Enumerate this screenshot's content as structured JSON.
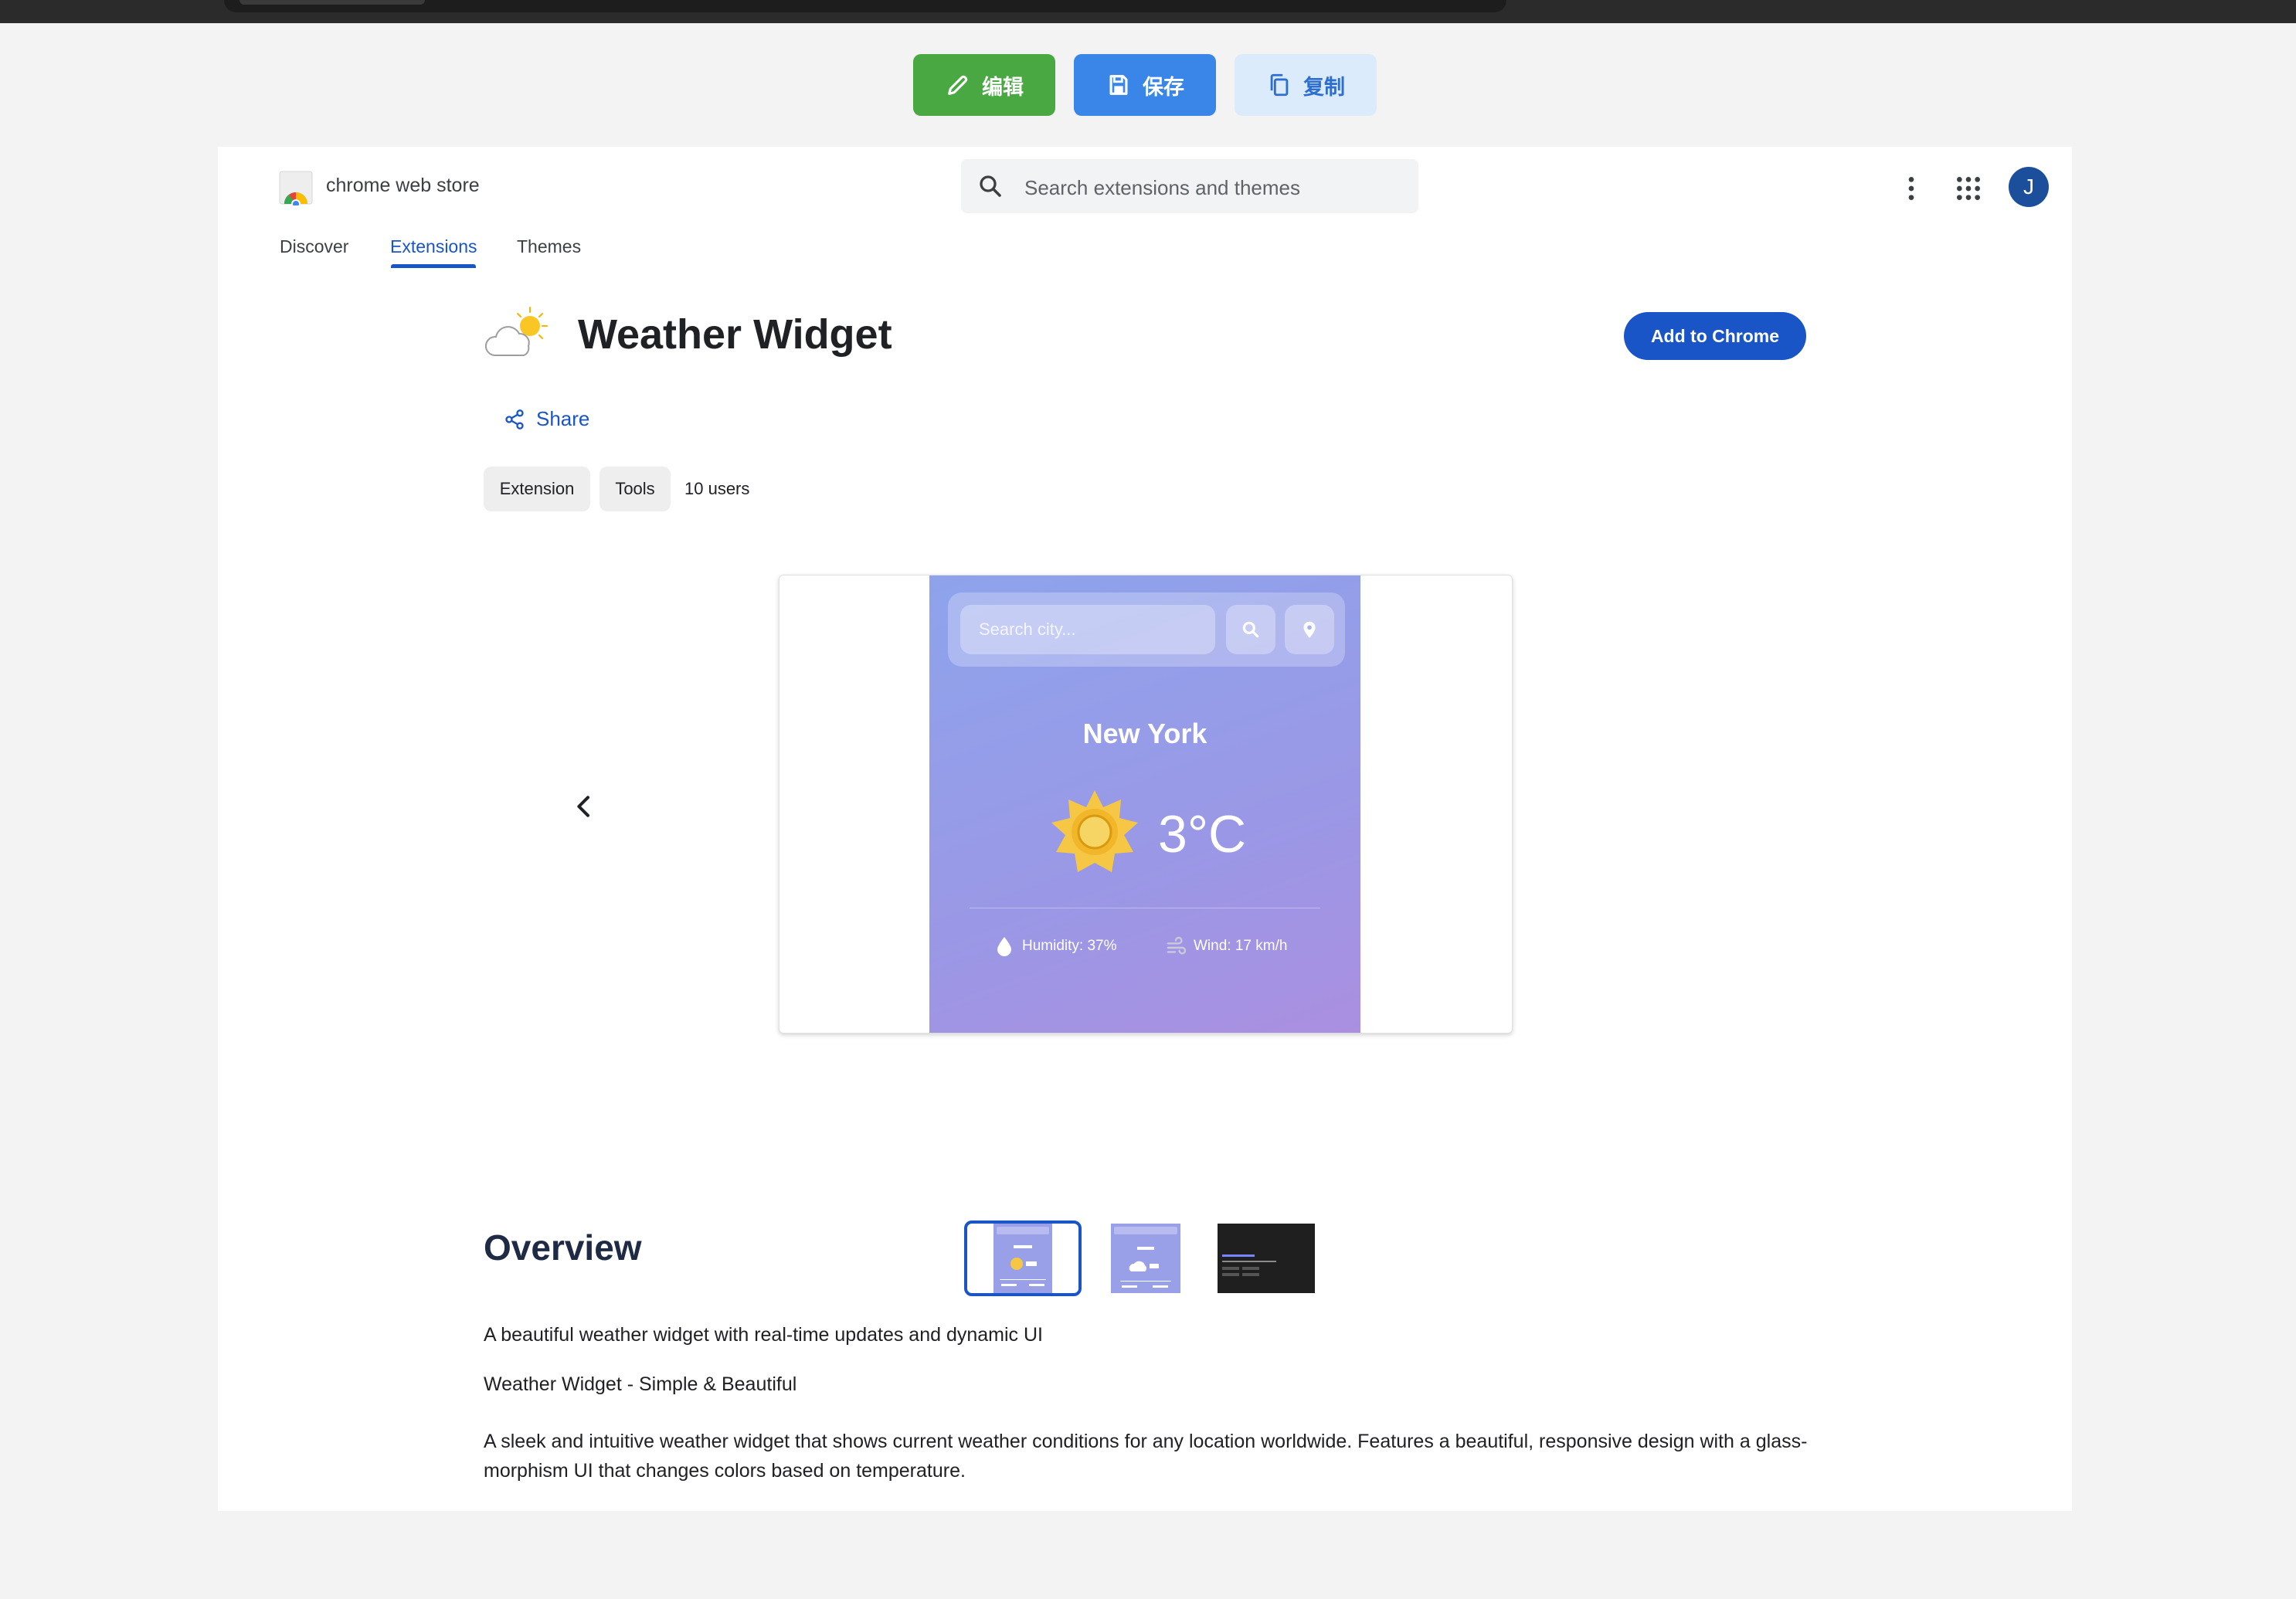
{
  "toolbar": {
    "edit_label": "编辑",
    "save_label": "保存",
    "copy_label": "复制"
  },
  "store": {
    "brand": "chrome web store",
    "search_placeholder": "Search extensions and themes",
    "avatar_initial": "J",
    "nav": [
      "Discover",
      "Extensions",
      "Themes"
    ],
    "active_nav": "Extensions"
  },
  "extension": {
    "title": "Weather Widget",
    "add_button": "Add to Chrome",
    "share": "Share",
    "chips": [
      "Extension",
      "Tools"
    ],
    "users": "10 users"
  },
  "screenshot": {
    "search_placeholder": "Search city...",
    "city": "New York",
    "temperature": "3°C",
    "humidity": "Humidity: 37%",
    "wind": "Wind: 17 km/h"
  },
  "overview": {
    "heading": "Overview",
    "summary": "A beautiful weather widget with real-time updates and dynamic UI",
    "tagline": "Weather Widget - Simple & Beautiful",
    "description": "A sleek and intuitive weather widget that shows current weather conditions for any location worldwide. Features a beautiful, responsive design with a glass-morphism UI that changes colors based on temperature."
  },
  "colors": {
    "accent": "#1a55c8",
    "edit_button": "#4aa843",
    "save_button": "#3a86e8",
    "copy_button": "#dcebfb"
  }
}
